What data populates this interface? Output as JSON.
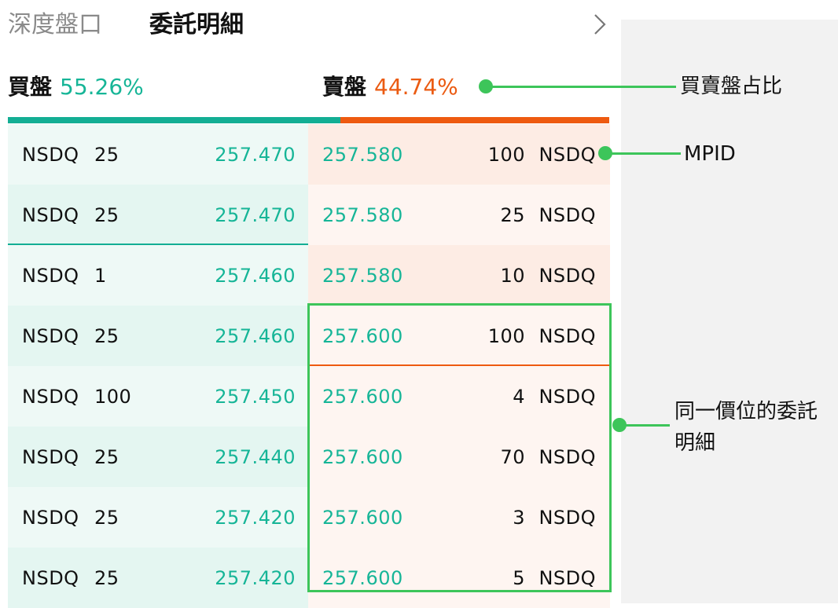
{
  "tabs": {
    "depth": "深度盤口",
    "detail": "委託明細"
  },
  "ratio": {
    "buy_label": "買盤",
    "buy_pct": "55.26%",
    "buy_value": 55.26,
    "sell_label": "賣盤",
    "sell_pct": "44.74%",
    "sell_value": 44.74
  },
  "bids": [
    {
      "mpid": "NSDQ",
      "size": "25",
      "price": "257.470"
    },
    {
      "mpid": "NSDQ",
      "size": "25",
      "price": "257.470"
    },
    {
      "mpid": "NSDQ",
      "size": "1",
      "price": "257.460"
    },
    {
      "mpid": "NSDQ",
      "size": "25",
      "price": "257.460"
    },
    {
      "mpid": "NSDQ",
      "size": "100",
      "price": "257.450"
    },
    {
      "mpid": "NSDQ",
      "size": "25",
      "price": "257.440"
    },
    {
      "mpid": "NSDQ",
      "size": "25",
      "price": "257.420"
    },
    {
      "mpid": "NSDQ",
      "size": "25",
      "price": "257.420"
    }
  ],
  "asks": [
    {
      "price": "257.580",
      "size": "100",
      "mpid": "NSDQ"
    },
    {
      "price": "257.580",
      "size": "25",
      "mpid": "NSDQ"
    },
    {
      "price": "257.580",
      "size": "10",
      "mpid": "NSDQ"
    },
    {
      "price": "257.600",
      "size": "100",
      "mpid": "NSDQ"
    },
    {
      "price": "257.600",
      "size": "4",
      "mpid": "NSDQ"
    },
    {
      "price": "257.600",
      "size": "70",
      "mpid": "NSDQ"
    },
    {
      "price": "257.600",
      "size": "3",
      "mpid": "NSDQ"
    },
    {
      "price": "257.600",
      "size": "5",
      "mpid": "NSDQ"
    }
  ],
  "annotations": {
    "ratio": "買賣盤占比",
    "mpid": "MPID",
    "same_price": "同一價位的委託明細"
  },
  "colors": {
    "buy": "#16b597",
    "sell": "#eb5b12",
    "annotation": "#3dc55a"
  }
}
